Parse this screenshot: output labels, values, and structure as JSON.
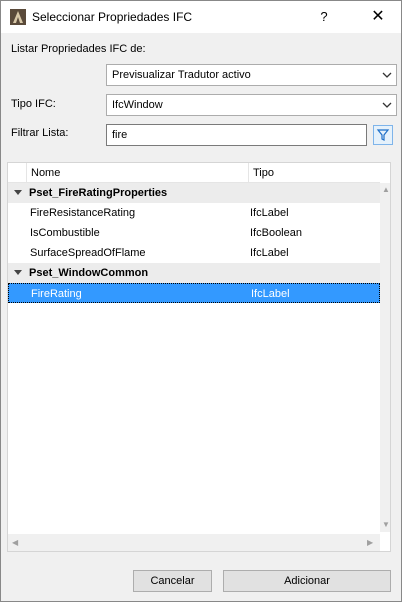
{
  "window": {
    "title": "Seleccionar Propriedades IFC",
    "help_label": "?",
    "close_label": "✕"
  },
  "form": {
    "list_from_label": "Listar Propriedades IFC de:",
    "list_from_value": "Previsualizar Tradutor activo",
    "ifc_type_label": "Tipo IFC:",
    "ifc_type_value": "IfcWindow",
    "filter_label": "Filtrar Lista:",
    "filter_value": "fire"
  },
  "table": {
    "columns": [
      "Nome",
      "Tipo"
    ],
    "groups": [
      {
        "name": "Pset_FireRatingProperties",
        "rows": [
          {
            "name": "FireResistanceRating",
            "type": "IfcLabel"
          },
          {
            "name": "IsCombustible",
            "type": "IfcBoolean"
          },
          {
            "name": "SurfaceSpreadOfFlame",
            "type": "IfcLabel"
          }
        ]
      },
      {
        "name": "Pset_WindowCommon",
        "rows": [
          {
            "name": "FireRating",
            "type": "IfcLabel",
            "selected": true
          }
        ]
      }
    ]
  },
  "footer": {
    "cancel_label": "Cancelar",
    "add_label": "Adicionar"
  },
  "colors": {
    "selection": "#3399ff",
    "group_band": "#ececec",
    "dialog_bg": "#f0f0f0"
  }
}
